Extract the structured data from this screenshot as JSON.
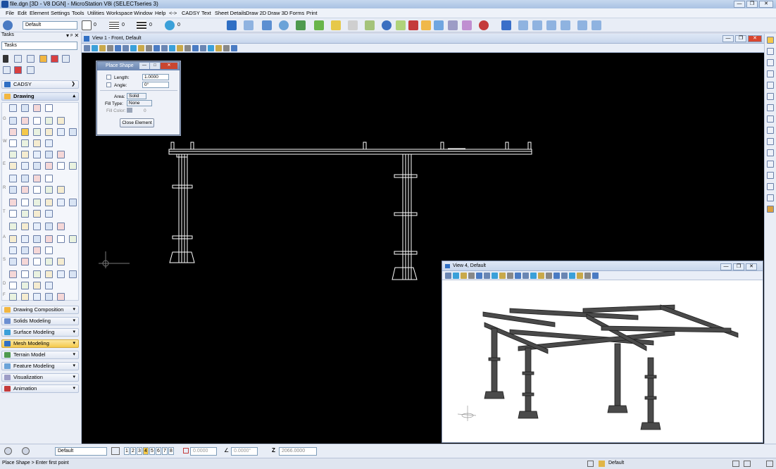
{
  "window": {
    "title": "file.dgn [3D - V8 DGN] - MicroStation V8i (SELECTseries 3)",
    "min": "—",
    "max": "❐",
    "close": "✕"
  },
  "menu": [
    "File",
    "Edit",
    "Element",
    "Settings",
    "Tools",
    "Utilities",
    "Workspace",
    "Window",
    "Help",
    "<->",
    "CADSY",
    "Text",
    "Sheet Details",
    "Draw 2D",
    "Draw 3D",
    "Forms",
    "Print"
  ],
  "toolbar": {
    "level_combo": "Default",
    "color_val": "0",
    "style_val": "0",
    "weight_val": "0",
    "trans_val": "0"
  },
  "left_panel": {
    "header": "Tasks",
    "tasks_combo": "Tasks",
    "cadsy": "CADSY",
    "drawing": "Drawing",
    "sections": [
      "Drawing Composition",
      "Solids Modeling",
      "Surface Modeling",
      "Mesh Modeling",
      "Terrain Model",
      "Feature Modeling",
      "Visualization",
      "Animation"
    ],
    "row_letters": [
      "G",
      "W",
      "E",
      "R",
      "T",
      "A",
      "S",
      "D",
      "F"
    ]
  },
  "view1": {
    "title": "View 1 - Front, Default"
  },
  "place_shape": {
    "title": "Place Shape",
    "length_label": "Length:",
    "length_value": "1.0000",
    "angle_label": "Angle:",
    "angle_value": "0°",
    "area_label": "Area:",
    "area_value": "Solid",
    "fill_type_label": "Fill Type:",
    "fill_type_value": "None",
    "fill_color_label": "Fill Color:",
    "fill_color_value": "0",
    "close_button": "Close Element"
  },
  "view4": {
    "title": "View 4, Default"
  },
  "status_row": {
    "level": "Default",
    "view_numbers": [
      "1",
      "2",
      "3",
      "4",
      "5",
      "6",
      "7",
      "8"
    ],
    "x_value": "0.0000",
    "angle_value": "0.0000°",
    "z_label": "Z",
    "z_value": "2066.0000"
  },
  "statusbar": {
    "prompt": "Place Shape > Enter first point",
    "level": "Default"
  }
}
